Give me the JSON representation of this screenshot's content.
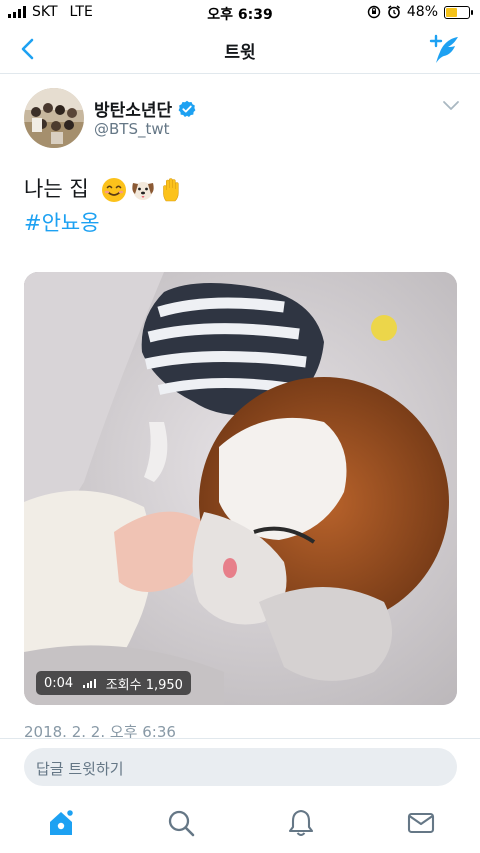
{
  "status_bar": {
    "carrier": "SKT",
    "network": "LTE",
    "time": "오후 6:39",
    "battery_percent": "48%",
    "battery_level": 0.48,
    "battery_color": "#f4c21a"
  },
  "nav": {
    "title": "트윗",
    "back_icon": "chevron-left-icon",
    "compose_icon": "compose-tweet-icon"
  },
  "tweet": {
    "author_name": "방탄소년단",
    "author_handle": "@BTS_twt",
    "text": "나는 집",
    "emojis": [
      "smiling-face-icon",
      "dog-face-icon",
      "raised-hand-icon"
    ],
    "hashtag": "#안뇨옹",
    "video_duration": "0:04",
    "view_count_label": "조회수 1,950",
    "timestamp": "2018. 2. 2. 오후 6:36",
    "reply_placeholder": "답글 트윗하기"
  },
  "tab_bar": {
    "items": [
      "home-icon",
      "search-icon",
      "notifications-icon",
      "messages-icon"
    ]
  },
  "colors": {
    "accent": "#1da1f2",
    "muted_text": "#657786"
  }
}
